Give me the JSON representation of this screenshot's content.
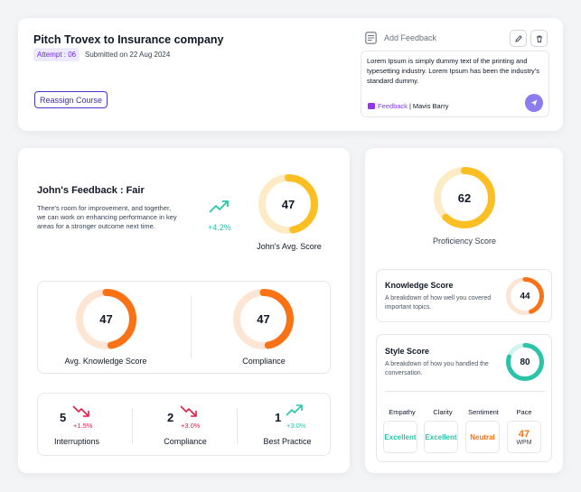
{
  "header": {
    "title": "Pitch Trovex to Insurance company",
    "attempt_badge": "Attempt : 06",
    "submitted": "Submitted on 22 Aug 2024",
    "reassign_label": "Reassign Course"
  },
  "feedback_box": {
    "title": "Add Feedback",
    "text": "Lorem Ipsum is simply dummy text of the printing and typesetting industry. Lorem Ipsum has been the industry's standard dummy.",
    "tag": "Feedback",
    "separator": "|",
    "author": "Mavis Barry"
  },
  "summary": {
    "title": "John's Feedback : Fair",
    "description": "There's room for improvement, and together, we can work on enhancing performance in key areas for a stronger outcome next time.",
    "trend": "+4.2%",
    "avg_score": 47,
    "avg_score_label": "John's Avg. Score"
  },
  "scores": {
    "knowledge": {
      "value": 47,
      "label": "Avg. Knowledge Score"
    },
    "compliance": {
      "value": 47,
      "label": "Compliance"
    }
  },
  "stats": [
    {
      "value": "5",
      "delta": "+1.5%",
      "label": "Interruptions",
      "direction": "down"
    },
    {
      "value": "2",
      "delta": "+3.0%",
      "label": "Compliance",
      "direction": "down"
    },
    {
      "value": "1",
      "delta": "+3.0%",
      "label": "Best Practice",
      "direction": "up"
    }
  ],
  "proficiency": {
    "value": 62,
    "label": "Proficiency Score"
  },
  "knowledge_card": {
    "title": "Knowledge Score",
    "description": "A breakdown of how well you covered important topics.",
    "value": 44
  },
  "style_card": {
    "title": "Style Score",
    "description": "A breakdown of how you handled the conversation.",
    "value": 80,
    "metrics": [
      {
        "label": "Empathy",
        "value": "Excellent"
      },
      {
        "label": "Clarity",
        "value": "Excellent"
      },
      {
        "label": "Sentiment",
        "value": "Neutral"
      },
      {
        "label": "Pace",
        "value": "47",
        "unit": "WPM"
      }
    ]
  },
  "colors": {
    "orange": "#f97316",
    "amber": "#fbbf24",
    "teal": "#2cc4a9",
    "red": "#e11d48",
    "purple": "#7c3aed",
    "indigo": "#3730a3"
  },
  "ring_fractions": {
    "avg": 0.47,
    "knowledge": 0.47,
    "compliance": 0.47,
    "proficiency": 0.62,
    "knowledge_card": 0.44,
    "style_card": 0.8
  }
}
